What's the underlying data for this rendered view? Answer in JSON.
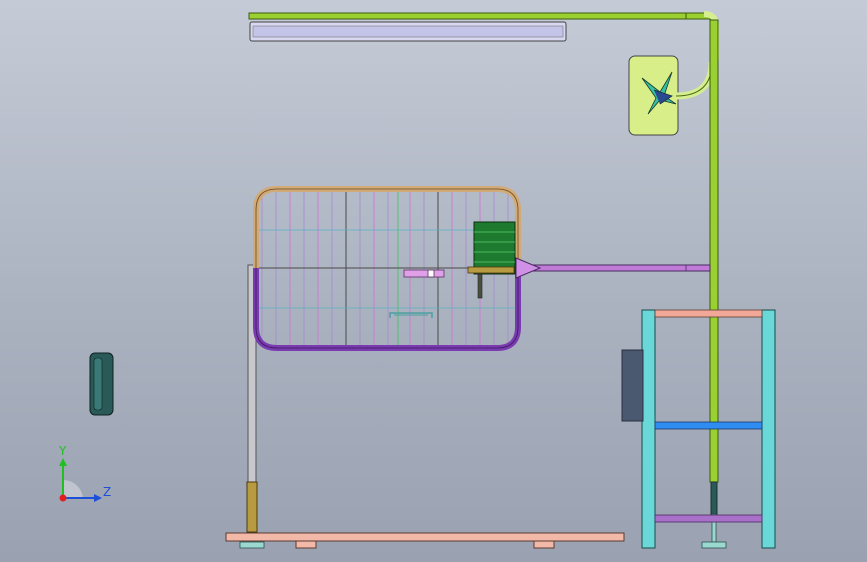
{
  "viewport": {
    "background_top": "#c5cbd6",
    "background_bottom": "#9aa2b2"
  },
  "triad": {
    "y_label": "Y",
    "z_label": "Z",
    "y_color": "#20c020",
    "z_color": "#1e4fd8",
    "x_color": "#e02020"
  },
  "model": {
    "parts": [
      "top-pipe",
      "light-bar",
      "sign-panel",
      "vertical-pole",
      "gate-frame",
      "gate-motor",
      "arm-pipe",
      "post-left",
      "base-plate",
      "tire",
      "stand-frame",
      "control-box"
    ],
    "colors": {
      "pipe_green": "#9ad030",
      "light_bar": "#d8d8f2",
      "sign_panel": "#d8ee88",
      "gate_top": "#d2aa78",
      "gate_bottom": "#7a3ab0",
      "motor": "#1e7a2e",
      "arm_pipe": "#c07ad8",
      "base_plate": "#f2b8a8",
      "tire": "#2a5a58",
      "frame_cyan": "#6ad8d8",
      "box_slate": "#4a5870",
      "bar_blue": "#2f8cf0",
      "bar_purple": "#a870c8",
      "bar_salmon": "#f2a898"
    }
  }
}
